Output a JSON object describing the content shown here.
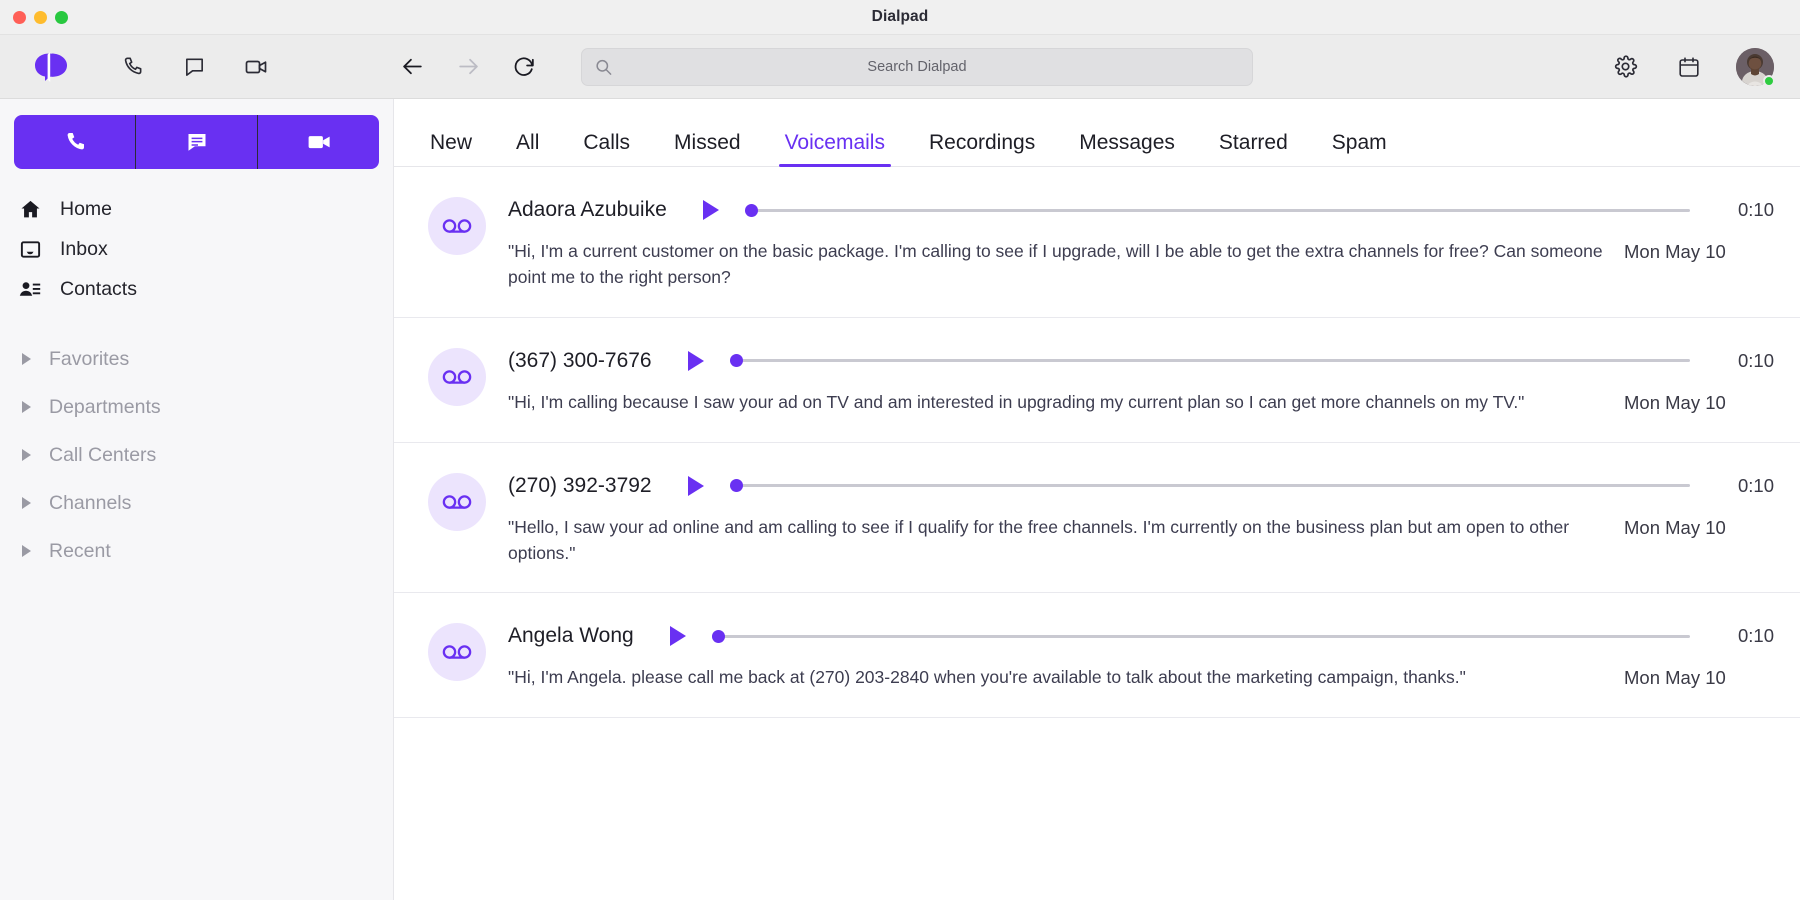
{
  "window": {
    "title": "Dialpad",
    "traffic_lights": [
      "close",
      "minimize",
      "maximize"
    ]
  },
  "toolbar": {
    "logo_name": "dialpad-logo",
    "left_icons": [
      {
        "name": "phone-icon",
        "label": "Phone"
      },
      {
        "name": "message-icon",
        "label": "Messages"
      },
      {
        "name": "video-icon",
        "label": "Video"
      }
    ],
    "nav": {
      "back_label": "Back",
      "forward_label": "Forward",
      "reload_label": "Reload",
      "back_enabled": true,
      "forward_enabled": false
    },
    "search": {
      "placeholder": "Search Dialpad",
      "value": ""
    },
    "right_icons": [
      {
        "name": "gear-icon",
        "label": "Settings"
      },
      {
        "name": "calendar-icon",
        "label": "Calendar"
      }
    ],
    "avatar": {
      "name": "user-avatar",
      "presence": "online",
      "presence_color": "#2ecc40"
    }
  },
  "sidebar": {
    "action_buttons": [
      {
        "name": "new-call-button",
        "icon": "phone-icon",
        "label": "New Call"
      },
      {
        "name": "new-message-button",
        "icon": "message-icon",
        "label": "New Message"
      },
      {
        "name": "new-meeting-button",
        "icon": "video-icon",
        "label": "New Meeting"
      }
    ],
    "accent_color": "#6930f2",
    "nav_items": [
      {
        "label": "Home",
        "icon": "home-icon"
      },
      {
        "label": "Inbox",
        "icon": "inbox-icon"
      },
      {
        "label": "Contacts",
        "icon": "contacts-icon"
      }
    ],
    "sections": [
      {
        "label": "Favorites",
        "expanded": false
      },
      {
        "label": "Departments",
        "expanded": false
      },
      {
        "label": "Call Centers",
        "expanded": false
      },
      {
        "label": "Channels",
        "expanded": false
      },
      {
        "label": "Recent",
        "expanded": false
      }
    ]
  },
  "main": {
    "tabs": [
      {
        "label": "New",
        "active": false
      },
      {
        "label": "All",
        "active": false
      },
      {
        "label": "Calls",
        "active": false
      },
      {
        "label": "Missed",
        "active": false
      },
      {
        "label": "Voicemails",
        "active": true
      },
      {
        "label": "Recordings",
        "active": false
      },
      {
        "label": "Messages",
        "active": false
      },
      {
        "label": "Starred",
        "active": false
      },
      {
        "label": "Spam",
        "active": false
      }
    ],
    "active_tab": "Voicemails",
    "voicemails": [
      {
        "name": "Adaora Azubuike",
        "avatar_icon": "voicemail-icon",
        "transcript": "\"Hi, I'm a current customer on the basic package. I'm calling to see if I upgrade, will I be able to get the extra channels for free? Can someone point me to the right person?",
        "duration": "0:10",
        "date": "Mon May 10",
        "progress": 0
      },
      {
        "name": "(367) 300-7676",
        "avatar_icon": "voicemail-icon",
        "transcript": "\"Hi, I'm calling because I saw your ad on TV and am interested in upgrading my current plan so I can get more channels on my TV.\"",
        "duration": "0:10",
        "date": "Mon May 10",
        "progress": 0
      },
      {
        "name": "(270) 392-3792",
        "avatar_icon": "voicemail-icon",
        "transcript": "\"Hello, I saw your ad online and am calling to see if I qualify for the free channels. I'm currently on the business plan but am open to other options.\"",
        "duration": "0:10",
        "date": "Mon May 10",
        "progress": 0
      },
      {
        "name": "Angela Wong",
        "avatar_icon": "voicemail-icon",
        "transcript": "\"Hi, I'm Angela. please call me back at (270) 203-2840 when you're available to talk about the marketing campaign, thanks.\"",
        "duration": "0:10",
        "date": "Mon May 10",
        "progress": 0
      }
    ]
  }
}
